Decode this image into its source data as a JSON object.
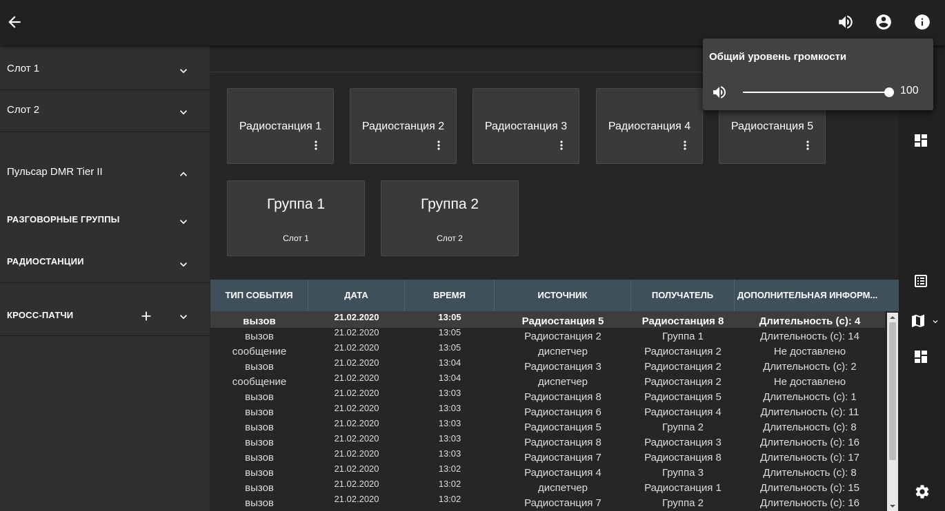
{
  "sidebar": {
    "slot1": "Слот 1",
    "slot2": "Слот 2",
    "system": "Пульсар DMR Tier II",
    "talkgroups": "РАЗГОВОРНЫЕ ГРУППЫ",
    "radios": "РАДИОСТАНЦИИ",
    "crosspatch": "КРОСС-ПАТЧИ"
  },
  "radios": [
    {
      "label": "Радиостанция 1"
    },
    {
      "label": "Радиостанция 2"
    },
    {
      "label": "Радиостанция 3"
    },
    {
      "label": "Радиостанция 4"
    },
    {
      "label": "Радиостанция 5"
    }
  ],
  "groups": [
    {
      "label": "Группа 1",
      "slot": "Слот 1"
    },
    {
      "label": "Группа 2",
      "slot": "Слот 2"
    }
  ],
  "table": {
    "headers": [
      "ТИП СОБЫТИЯ",
      "ДАТА",
      "ВРЕМЯ",
      "ИСТОЧНИК",
      "ПОЛУЧАТЕЛЬ",
      "ДОПОЛНИТЕЛЬНАЯ ИНФОРМ..."
    ],
    "rows": [
      {
        "type": "вызов",
        "date": "21.02.2020",
        "time": "13:05",
        "source": "Радиостанция 5",
        "target": "Радиостанция 8",
        "info": "Длительность (с): 4"
      },
      {
        "type": "вызов",
        "date": "21.02.2020",
        "time": "13:05",
        "source": "Радиостанция 2",
        "target": "Группа 1",
        "info": "Длительность (с): 14"
      },
      {
        "type": "сообщение",
        "date": "21.02.2020",
        "time": "13:05",
        "source": "диспетчер",
        "target": "Радиостанция 2",
        "info": "Не доставлено"
      },
      {
        "type": "вызов",
        "date": "21.02.2020",
        "time": "13:04",
        "source": "Радиостанция 3",
        "target": "Радиостанция 2",
        "info": "Длительность (с): 2"
      },
      {
        "type": "сообщение",
        "date": "21.02.2020",
        "time": "13:04",
        "source": "диспетчер",
        "target": "Радиостанция 2",
        "info": "Не доставлено"
      },
      {
        "type": "вызов",
        "date": "21.02.2020",
        "time": "13:03",
        "source": "Радиостанция 8",
        "target": "Радиостанция 5",
        "info": "Длительность (с): 1"
      },
      {
        "type": "вызов",
        "date": "21.02.2020",
        "time": "13:03",
        "source": "Радиостанция 6",
        "target": "Радиостанция 4",
        "info": "Длительность (с): 11"
      },
      {
        "type": "вызов",
        "date": "21.02.2020",
        "time": "13:03",
        "source": "Радиостанция 5",
        "target": "Группа 2",
        "info": "Длительность (с): 8"
      },
      {
        "type": "вызов",
        "date": "21.02.2020",
        "time": "13:03",
        "source": "Радиостанция 8",
        "target": "Радиостанция 3",
        "info": "Длительность (с): 16"
      },
      {
        "type": "вызов",
        "date": "21.02.2020",
        "time": "13:03",
        "source": "Радиостанция 7",
        "target": "Радиостанция 8",
        "info": "Длительность (с): 17"
      },
      {
        "type": "вызов",
        "date": "21.02.2020",
        "time": "13:02",
        "source": "Радиостанция 4",
        "target": "Группа 3",
        "info": "Длительность (с): 8"
      },
      {
        "type": "вызов",
        "date": "21.02.2020",
        "time": "13:02",
        "source": "диспетчер",
        "target": "Радиостанция 1",
        "info": "Длительность (с): 15"
      },
      {
        "type": "вызов",
        "date": "21.02.2020",
        "time": "13:02",
        "source": "Радиостанция 7",
        "target": "Группа 2",
        "info": "Длительность (с): 16"
      }
    ]
  },
  "volume": {
    "title": "Общий уровень громкости",
    "value": "100",
    "level_percent": 100
  },
  "colors": {
    "background": "#212121",
    "sidebar": "#303030",
    "card": "#3a3a3a",
    "table_header": "#40505a",
    "popup": "#424242"
  },
  "icons": {
    "back": "arrow-left-icon",
    "volume": "volume-icon",
    "account": "account-icon",
    "info": "info-icon",
    "more": "more-vert-icon",
    "dashboard": "dashboard-icon",
    "list": "list-icon",
    "map": "map-icon",
    "settings": "gear-icon",
    "expand": "chevron-down-icon",
    "collapse": "chevron-up-icon",
    "add": "plus-icon"
  }
}
